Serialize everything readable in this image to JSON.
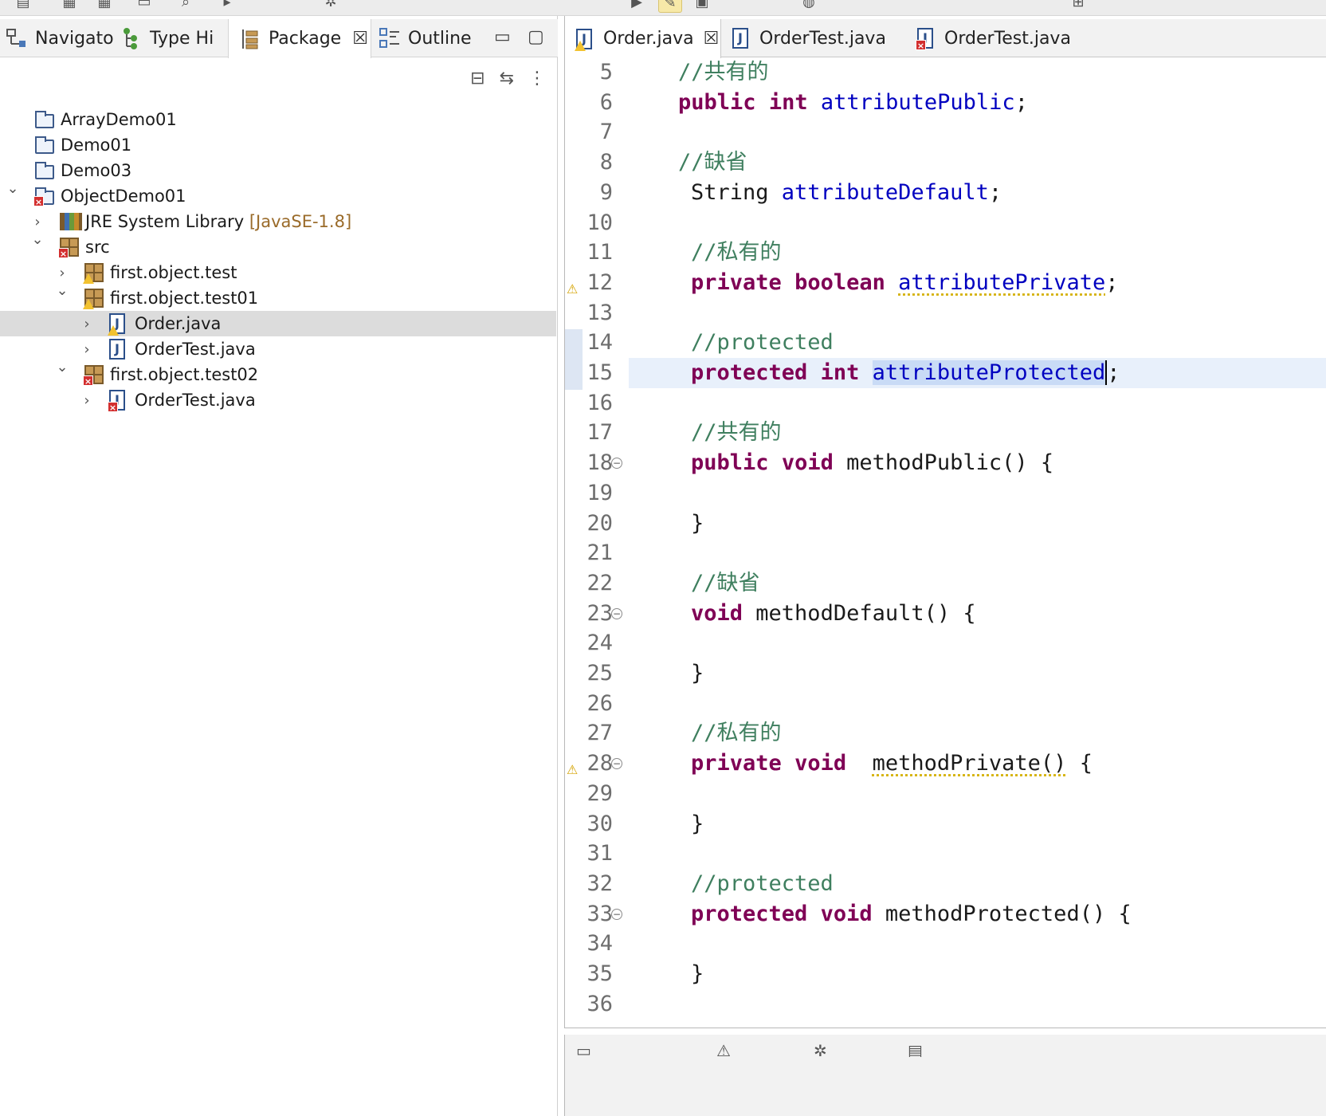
{
  "toolbar": {
    "buttons": [
      {
        "icon": "new-file-icon",
        "glyph": "▤"
      },
      {
        "icon": "save-icon",
        "glyph": "▦"
      },
      {
        "icon": "save-all-icon",
        "glyph": "▦"
      },
      {
        "icon": "terminal-icon",
        "glyph": "▭"
      },
      {
        "icon": "search-icon",
        "glyph": "⌕"
      },
      {
        "icon": "step-icon",
        "glyph": "▸"
      },
      {
        "icon": "debug-icon",
        "glyph": "✲"
      },
      {
        "icon": "run-icon",
        "glyph": "▶"
      },
      {
        "icon": "highlight-icon",
        "glyph": "✎"
      },
      {
        "icon": "open-type-icon",
        "glyph": "▣"
      },
      {
        "icon": "globe-icon",
        "glyph": "◍"
      },
      {
        "icon": "folder-open-icon",
        "glyph": "⊞"
      }
    ]
  },
  "left_panel": {
    "tabs": [
      {
        "label": "Navigato",
        "icon": "navigator-icon"
      },
      {
        "label": "Type Hi",
        "icon": "type-hierarchy-icon"
      },
      {
        "label": "Package",
        "icon": "package-explorer-icon",
        "active": true
      },
      {
        "label": "Outline",
        "icon": "outline-icon"
      }
    ],
    "close_glyph": "☒",
    "minimize_glyph": "▭",
    "maximize_glyph": "▢",
    "actions": [
      {
        "icon": "collapse-all-icon",
        "glyph": "⊟"
      },
      {
        "icon": "link-with-editor-icon",
        "glyph": "⇆"
      },
      {
        "icon": "view-menu-icon",
        "glyph": "⋮"
      }
    ]
  },
  "tree": [
    {
      "label": "ArrayDemo01",
      "icon": "project-folder-icon",
      "depth": 0
    },
    {
      "label": "Demo01",
      "icon": "project-folder-icon",
      "depth": 0
    },
    {
      "label": "Demo03",
      "icon": "project-folder-icon",
      "depth": 0
    },
    {
      "label": "ObjectDemo01",
      "icon": "java-project-icon",
      "depth": 0,
      "expanded": true,
      "overlay": "error"
    },
    {
      "label": "JRE System Library",
      "decoration": "[JavaSE-1.8]",
      "icon": "library-icon",
      "depth": 1,
      "expanded": false
    },
    {
      "label": "src",
      "icon": "source-folder-icon",
      "depth": 1,
      "expanded": true,
      "overlay": "error"
    },
    {
      "label": "first.object.test",
      "icon": "package-icon",
      "depth": 2,
      "expanded": false,
      "overlay": "warning"
    },
    {
      "label": "first.object.test01",
      "icon": "package-icon",
      "depth": 2,
      "expanded": true,
      "overlay": "warning"
    },
    {
      "label": "Order.java",
      "icon": "java-file-icon",
      "depth": 3,
      "expanded": false,
      "overlay": "warning",
      "selected": true
    },
    {
      "label": "OrderTest.java",
      "icon": "java-file-icon",
      "depth": 3,
      "expanded": false
    },
    {
      "label": "first.object.test02",
      "icon": "package-icon",
      "depth": 2,
      "expanded": true,
      "overlay": "error"
    },
    {
      "label": "OrderTest.java",
      "icon": "java-file-icon",
      "depth": 3,
      "expanded": false,
      "overlay": "error"
    }
  ],
  "editor": {
    "tabs": [
      {
        "label": "Order.java",
        "active": true,
        "overlay": "warning"
      },
      {
        "label": "OrderTest.java"
      },
      {
        "label": "OrderTest.java",
        "overlay": "error"
      }
    ],
    "close_glyph": "☒",
    "lines": [
      {
        "n": "5",
        "indent": 0,
        "tokens": [
          {
            "t": "//共有的",
            "c": "cmt"
          }
        ]
      },
      {
        "n": "6",
        "indent": 0,
        "tokens": [
          {
            "t": "public",
            "c": "kw"
          },
          {
            "t": " "
          },
          {
            "t": "int",
            "c": "kw"
          },
          {
            "t": " "
          },
          {
            "t": "attributePublic",
            "c": "fld"
          },
          {
            "t": ";"
          }
        ]
      },
      {
        "n": "7",
        "indent": 0,
        "tokens": []
      },
      {
        "n": "8",
        "indent": 0,
        "tokens": [
          {
            "t": "//缺省",
            "c": "cmt"
          }
        ]
      },
      {
        "n": "9",
        "indent": 1,
        "tokens": [
          {
            "t": "String "
          },
          {
            "t": "attributeDefault",
            "c": "fld"
          },
          {
            "t": ";"
          }
        ]
      },
      {
        "n": "10",
        "indent": 1,
        "tokens": []
      },
      {
        "n": "11",
        "indent": 1,
        "tokens": [
          {
            "t": "//私有的",
            "c": "cmt"
          }
        ]
      },
      {
        "n": "12",
        "indent": 1,
        "marker": "warning",
        "tokens": [
          {
            "t": "private",
            "c": "kw"
          },
          {
            "t": " "
          },
          {
            "t": "boolean",
            "c": "kw"
          },
          {
            "t": " "
          },
          {
            "t": "attributePrivate",
            "c": "fld warn-ul"
          },
          {
            "t": ";"
          }
        ]
      },
      {
        "n": "13",
        "indent": 1,
        "tokens": []
      },
      {
        "n": "14",
        "indent": 1,
        "tokens": [
          {
            "t": "//protected",
            "c": "cmt"
          }
        ]
      },
      {
        "n": "15",
        "indent": 1,
        "current": true,
        "tokens": [
          {
            "t": "protected",
            "c": "kw"
          },
          {
            "t": " "
          },
          {
            "t": "int",
            "c": "kw"
          },
          {
            "t": " "
          },
          {
            "t": "attributeProtected",
            "c": "fld sel caret"
          },
          {
            "t": ";"
          }
        ]
      },
      {
        "n": "16",
        "indent": 1,
        "tokens": []
      },
      {
        "n": "17",
        "indent": 1,
        "tokens": [
          {
            "t": "//共有的",
            "c": "cmt"
          }
        ]
      },
      {
        "n": "18",
        "indent": 1,
        "fold": true,
        "tokens": [
          {
            "t": "public",
            "c": "kw"
          },
          {
            "t": " "
          },
          {
            "t": "void",
            "c": "kw"
          },
          {
            "t": " methodPublic() {"
          }
        ]
      },
      {
        "n": "19",
        "indent": 1,
        "tokens": []
      },
      {
        "n": "20",
        "indent": 1,
        "tokens": [
          {
            "t": "}"
          }
        ]
      },
      {
        "n": "21",
        "indent": 1,
        "tokens": []
      },
      {
        "n": "22",
        "indent": 1,
        "tokens": [
          {
            "t": "//缺省",
            "c": "cmt"
          }
        ]
      },
      {
        "n": "23",
        "indent": 1,
        "fold": true,
        "tokens": [
          {
            "t": "void",
            "c": "kw"
          },
          {
            "t": " methodDefault() {"
          }
        ]
      },
      {
        "n": "24",
        "indent": 1,
        "tokens": []
      },
      {
        "n": "25",
        "indent": 1,
        "tokens": [
          {
            "t": "}"
          }
        ]
      },
      {
        "n": "26",
        "indent": 1,
        "tokens": []
      },
      {
        "n": "27",
        "indent": 1,
        "tokens": [
          {
            "t": "//私有的",
            "c": "cmt"
          }
        ]
      },
      {
        "n": "28",
        "indent": 1,
        "fold": true,
        "marker": "warning",
        "tokens": [
          {
            "t": "private",
            "c": "kw"
          },
          {
            "t": " "
          },
          {
            "t": "void",
            "c": "kw"
          },
          {
            "t": "  "
          },
          {
            "t": "methodPrivate()",
            "c": "warn-ul"
          },
          {
            "t": " {"
          }
        ]
      },
      {
        "n": "29",
        "indent": 1,
        "tokens": []
      },
      {
        "n": "30",
        "indent": 1,
        "tokens": [
          {
            "t": "}"
          }
        ]
      },
      {
        "n": "31",
        "indent": 1,
        "tokens": []
      },
      {
        "n": "32",
        "indent": 1,
        "tokens": [
          {
            "t": "//protected",
            "c": "cmt"
          }
        ]
      },
      {
        "n": "33",
        "indent": 1,
        "fold": true,
        "tokens": [
          {
            "t": "protected",
            "c": "kw"
          },
          {
            "t": " "
          },
          {
            "t": "void",
            "c": "kw"
          },
          {
            "t": " methodProtected() {"
          }
        ]
      },
      {
        "n": "34",
        "indent": 1,
        "tokens": []
      },
      {
        "n": "35",
        "indent": 1,
        "tokens": [
          {
            "t": "}"
          }
        ]
      },
      {
        "n": "36",
        "indent": 1,
        "tokens": []
      }
    ]
  },
  "bottom_panel": {
    "tabs": [
      {
        "icon": "console-icon"
      },
      {
        "icon": "problems-icon"
      },
      {
        "icon": "debug-shell-icon"
      },
      {
        "icon": "coverage-icon"
      }
    ]
  },
  "colors": {
    "keyword": "#7f0055",
    "field": "#0000c0",
    "comment": "#3f7f5f",
    "selection": "#c9dbf6",
    "current_line": "#e8f0fb",
    "tree_selected": "#dcdcdc"
  }
}
